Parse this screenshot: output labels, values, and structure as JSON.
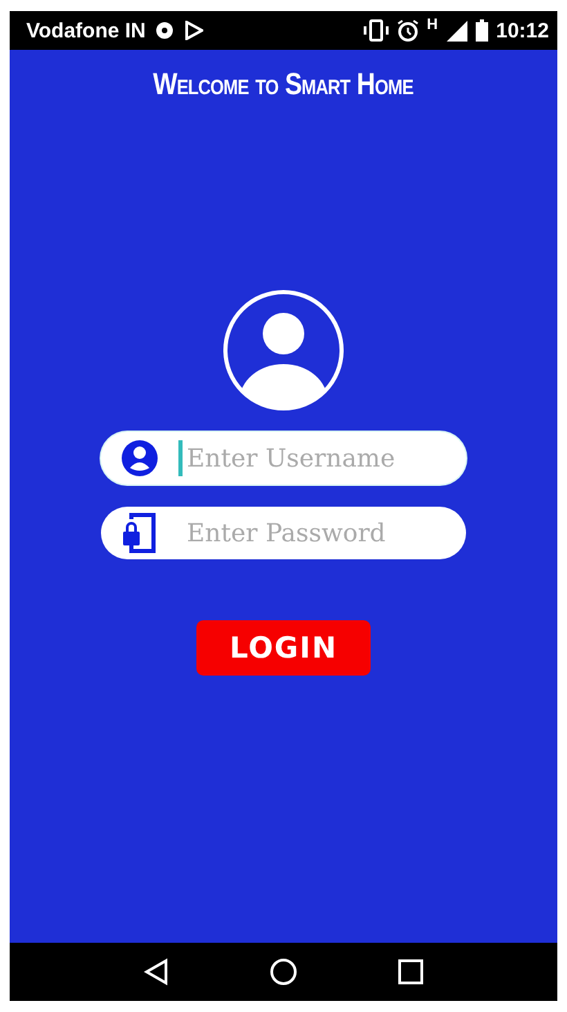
{
  "status_bar": {
    "carrier": "Vodafone IN",
    "time": "10:12",
    "network": "H"
  },
  "title": "Welcome to Smart Home",
  "fields": [
    {
      "kind": "username",
      "placeholder": "Enter Username",
      "focused": true
    },
    {
      "kind": "password",
      "placeholder": "Enter Password",
      "focused": false
    }
  ],
  "login_button": "LOGIN"
}
